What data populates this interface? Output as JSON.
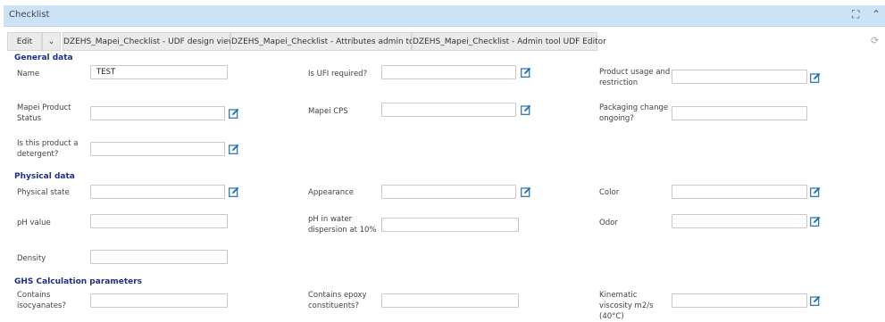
{
  "window": {
    "title": "Checklist",
    "expand_glyph": "⛶",
    "collapse_glyph": "⌃"
  },
  "toolbar": {
    "edit_label": "Edit",
    "dropdown_glyph": "⌄",
    "tab1": "DZEHS_Mapei_Checklist - UDF design view",
    "tab2": "DZEHS_Mapei_Checklist - Attributes admin tool",
    "tab3": "DZEHS_Mapei_Checklist - Admin tool UDF Editor",
    "refresh_glyph": "⟳"
  },
  "sections": {
    "general": "General data",
    "physical": "Physical data",
    "ghs": "GHS Calculation parameters"
  },
  "fields": {
    "name": {
      "label": "Name",
      "value": "TEST"
    },
    "ufi": {
      "label": "Is UFI required?",
      "value": ""
    },
    "usage": {
      "label": "Product usage and restriction",
      "value": ""
    },
    "status": {
      "label": "Mapei Product Status",
      "value": ""
    },
    "cps": {
      "label": "Mapei CPS",
      "value": ""
    },
    "packaging": {
      "label": "Packaging change ongoing?",
      "value": ""
    },
    "detergent": {
      "label": "Is this product a detergent?",
      "value": ""
    },
    "physical_state": {
      "label": "Physical state",
      "value": ""
    },
    "appearance": {
      "label": "Appearance",
      "value": ""
    },
    "color": {
      "label": "Color",
      "value": ""
    },
    "ph": {
      "label": "pH value",
      "value": ""
    },
    "ph_water": {
      "label": "pH in water dispersion at 10%",
      "value": ""
    },
    "odor": {
      "label": "Odor",
      "value": ""
    },
    "density": {
      "label": "Density",
      "value": ""
    },
    "isocyanates": {
      "label": "Contains isocyanates?",
      "value": ""
    },
    "epoxy": {
      "label": "Contains epoxy constituents?",
      "value": ""
    },
    "viscosity": {
      "label": "Kinematic viscosity m2/s (40°C)",
      "value": ""
    }
  },
  "colors": {
    "titlebar_bg": "#cce3f7",
    "section_text": "#1f2f8a",
    "edit_icon": "#1e6fb8"
  },
  "icons": {
    "edit": "edit-pencil-icon",
    "expand": "expand-icon",
    "collapse": "collapse-chevron-icon",
    "refresh": "refresh-icon"
  }
}
